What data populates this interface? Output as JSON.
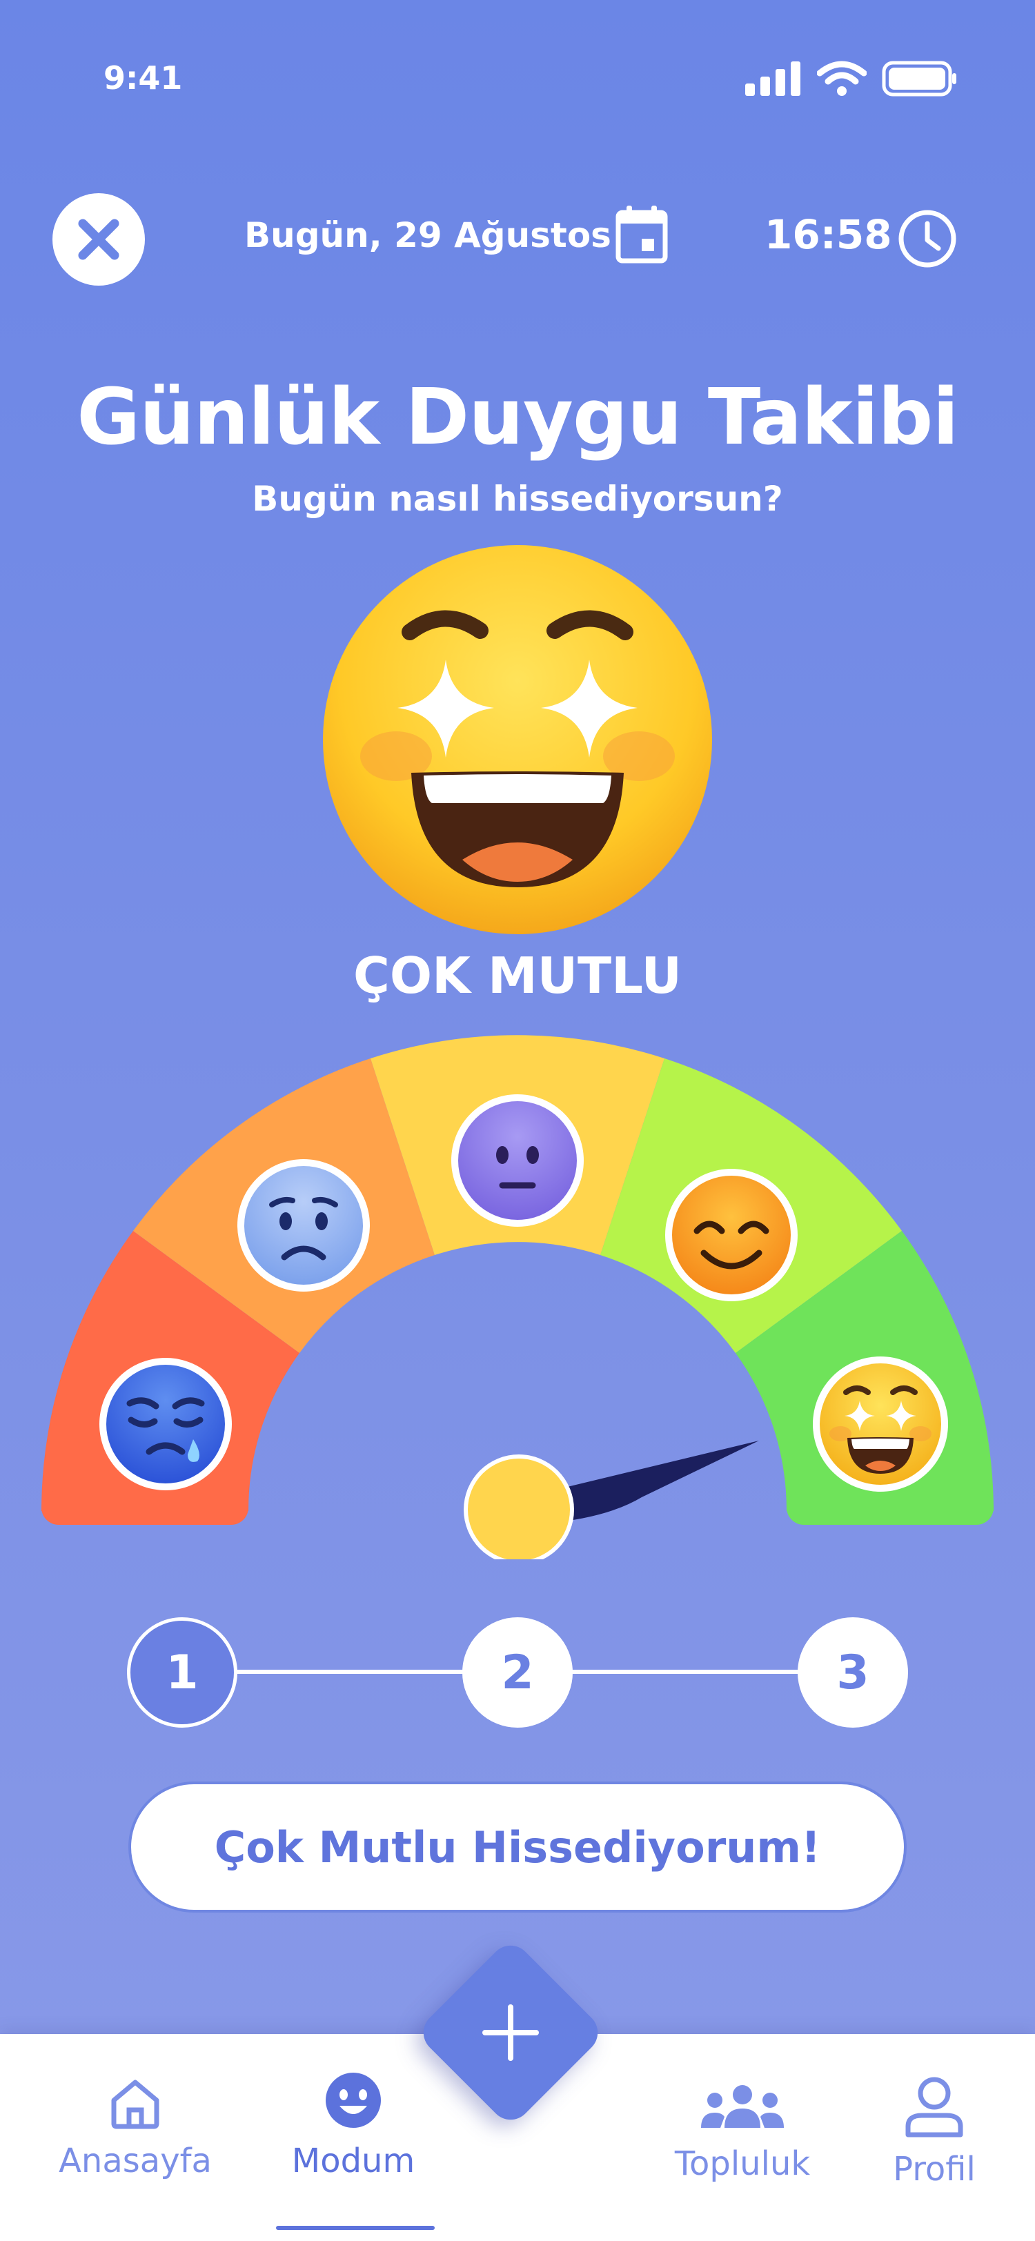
{
  "status_bar": {
    "time": "9:41"
  },
  "header": {
    "date": "Bugün, 29 Ağustos",
    "time": "16:58"
  },
  "title": "Günlük Duygu Takibi",
  "subtitle": "Bugün nasıl hissediyorsun?",
  "selected_mood": {
    "label": "ÇOK MUTLU",
    "level": 5,
    "max_level": 5
  },
  "mood_scale": [
    {
      "icon": "sad-crying-face-icon",
      "color": "#ff6b48"
    },
    {
      "icon": "worried-face-icon",
      "color": "#ffa24a"
    },
    {
      "icon": "neutral-face-icon",
      "color": "#ffd54d"
    },
    {
      "icon": "smiling-face-icon",
      "color": "#b6f34a"
    },
    {
      "icon": "star-struck-face-icon",
      "color": "#6fe35a"
    }
  ],
  "stepper": {
    "steps": [
      "1",
      "2",
      "3"
    ],
    "current": 1
  },
  "cta_label": "Çok Mutlu Hissediyorum!",
  "nav": {
    "home": "Anasayfa",
    "mood": "Modum",
    "community": "Topluluk",
    "profile": "Profil",
    "active": "mood"
  },
  "colors": {
    "background": "#6b86e6",
    "accent": "#5f74dc",
    "needle": "#1b1f5e",
    "pivot": "#ffd54d"
  }
}
